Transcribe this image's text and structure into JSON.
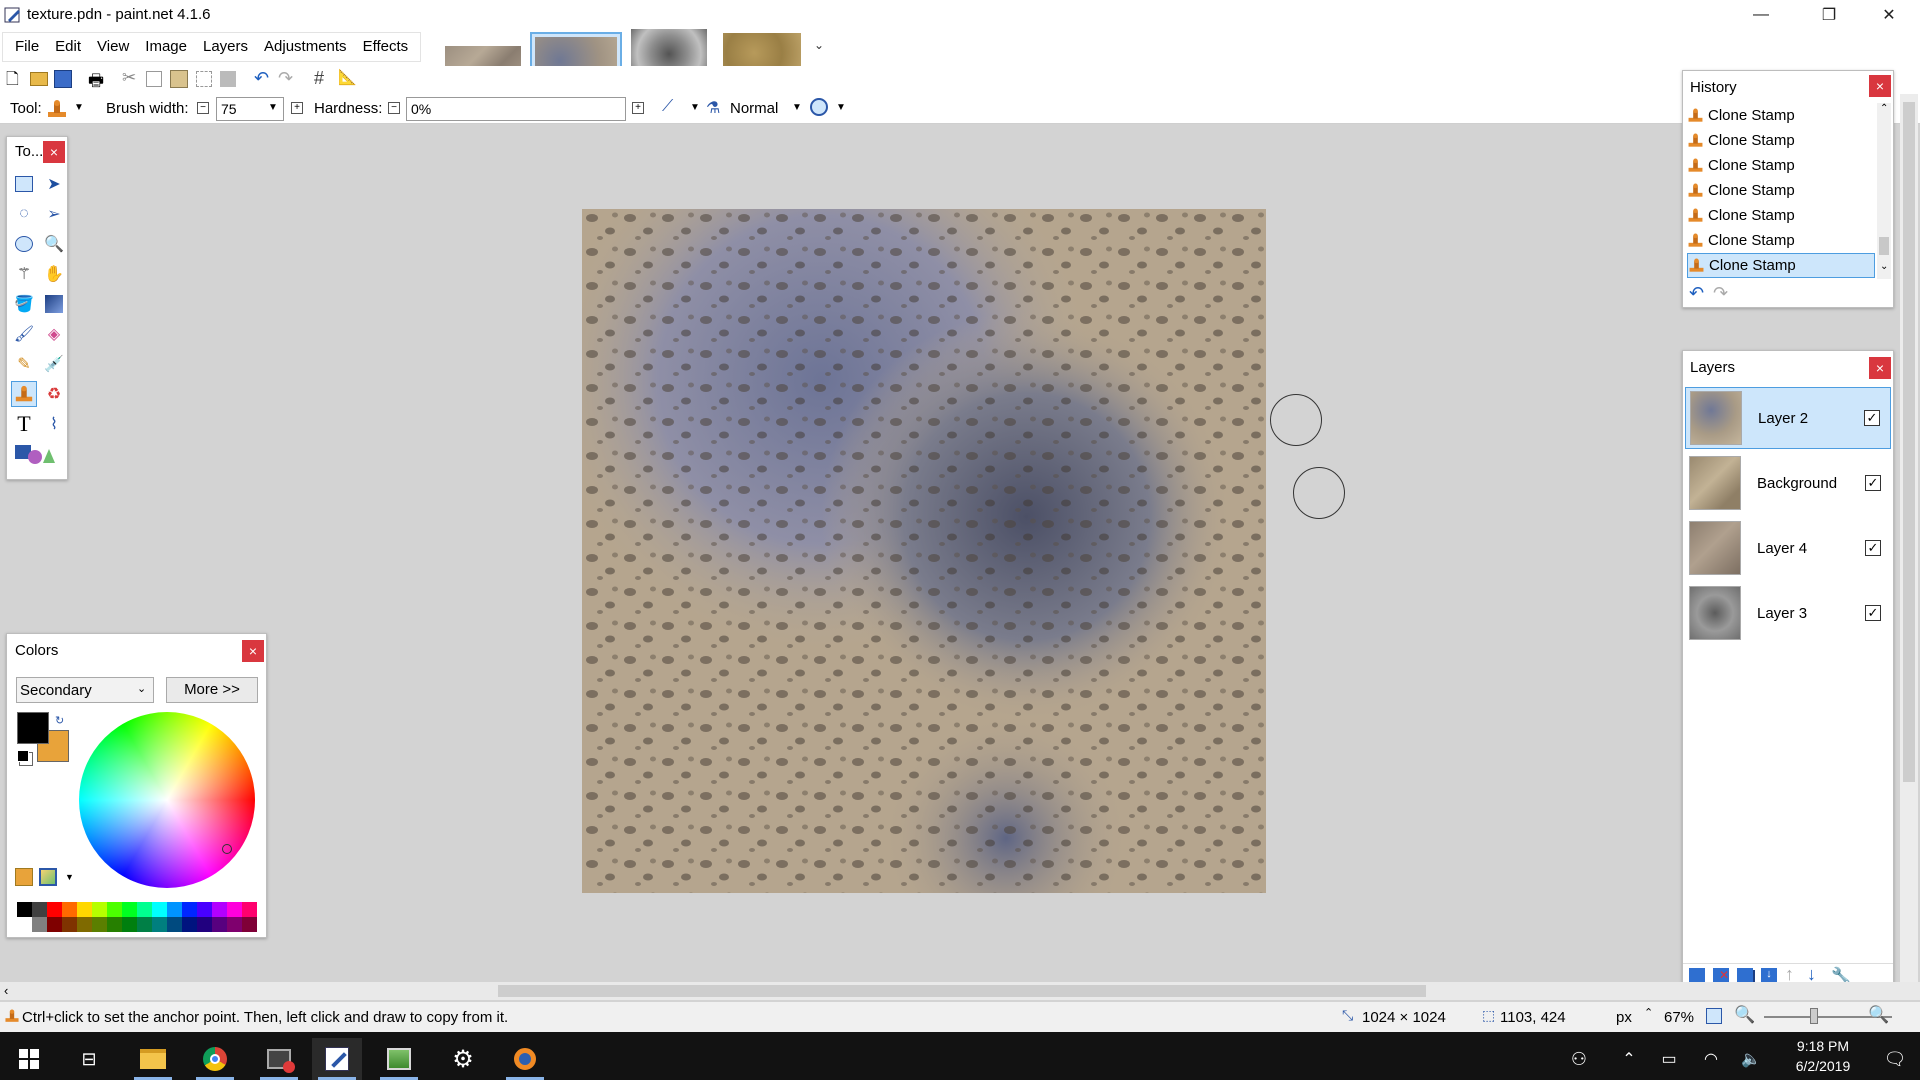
{
  "window": {
    "title": "texture.pdn - paint.net 4.1.6",
    "minimize_glyph": "—",
    "restore_glyph": "❐",
    "close_glyph": "✕"
  },
  "menu": {
    "items": [
      "File",
      "Edit",
      "View",
      "Image",
      "Layers",
      "Adjustments",
      "Effects"
    ]
  },
  "toolbar": {
    "tool_label": "Tool:",
    "brush_width_label": "Brush width:",
    "brush_width_value": "75",
    "hardness_label": "Hardness:",
    "hardness_value": "0%",
    "blend_mode": "Normal"
  },
  "tools_panel": {
    "title": "To...",
    "close": "×"
  },
  "colors_panel": {
    "title": "Colors",
    "close": "×",
    "selector_value": "Secondary",
    "more_button": "More >>",
    "primary_color": "#000000",
    "secondary_color": "#e8a33a"
  },
  "history_panel": {
    "title": "History",
    "close": "×",
    "items": [
      "Clone Stamp",
      "Clone Stamp",
      "Clone Stamp",
      "Clone Stamp",
      "Clone Stamp",
      "Clone Stamp",
      "Clone Stamp"
    ],
    "selected_index": 6
  },
  "layers_panel": {
    "title": "Layers",
    "close": "×",
    "layers": [
      {
        "name": "Layer 2",
        "visible": true,
        "selected": true
      },
      {
        "name": "Background",
        "visible": true,
        "selected": false
      },
      {
        "name": "Layer 4",
        "visible": true,
        "selected": false
      },
      {
        "name": "Layer 3",
        "visible": true,
        "selected": false
      }
    ]
  },
  "status": {
    "hint": "Ctrl+click to set the anchor point. Then, left click and draw to copy from it.",
    "image_size": "1024 × 1024",
    "cursor_pos": "1103, 424",
    "unit": "px",
    "zoom": "67%"
  },
  "taskbar": {
    "time": "9:18 PM",
    "date": "6/2/2019"
  },
  "colors": {
    "accent": "#4d9de0",
    "close_red": "#d9373f"
  }
}
